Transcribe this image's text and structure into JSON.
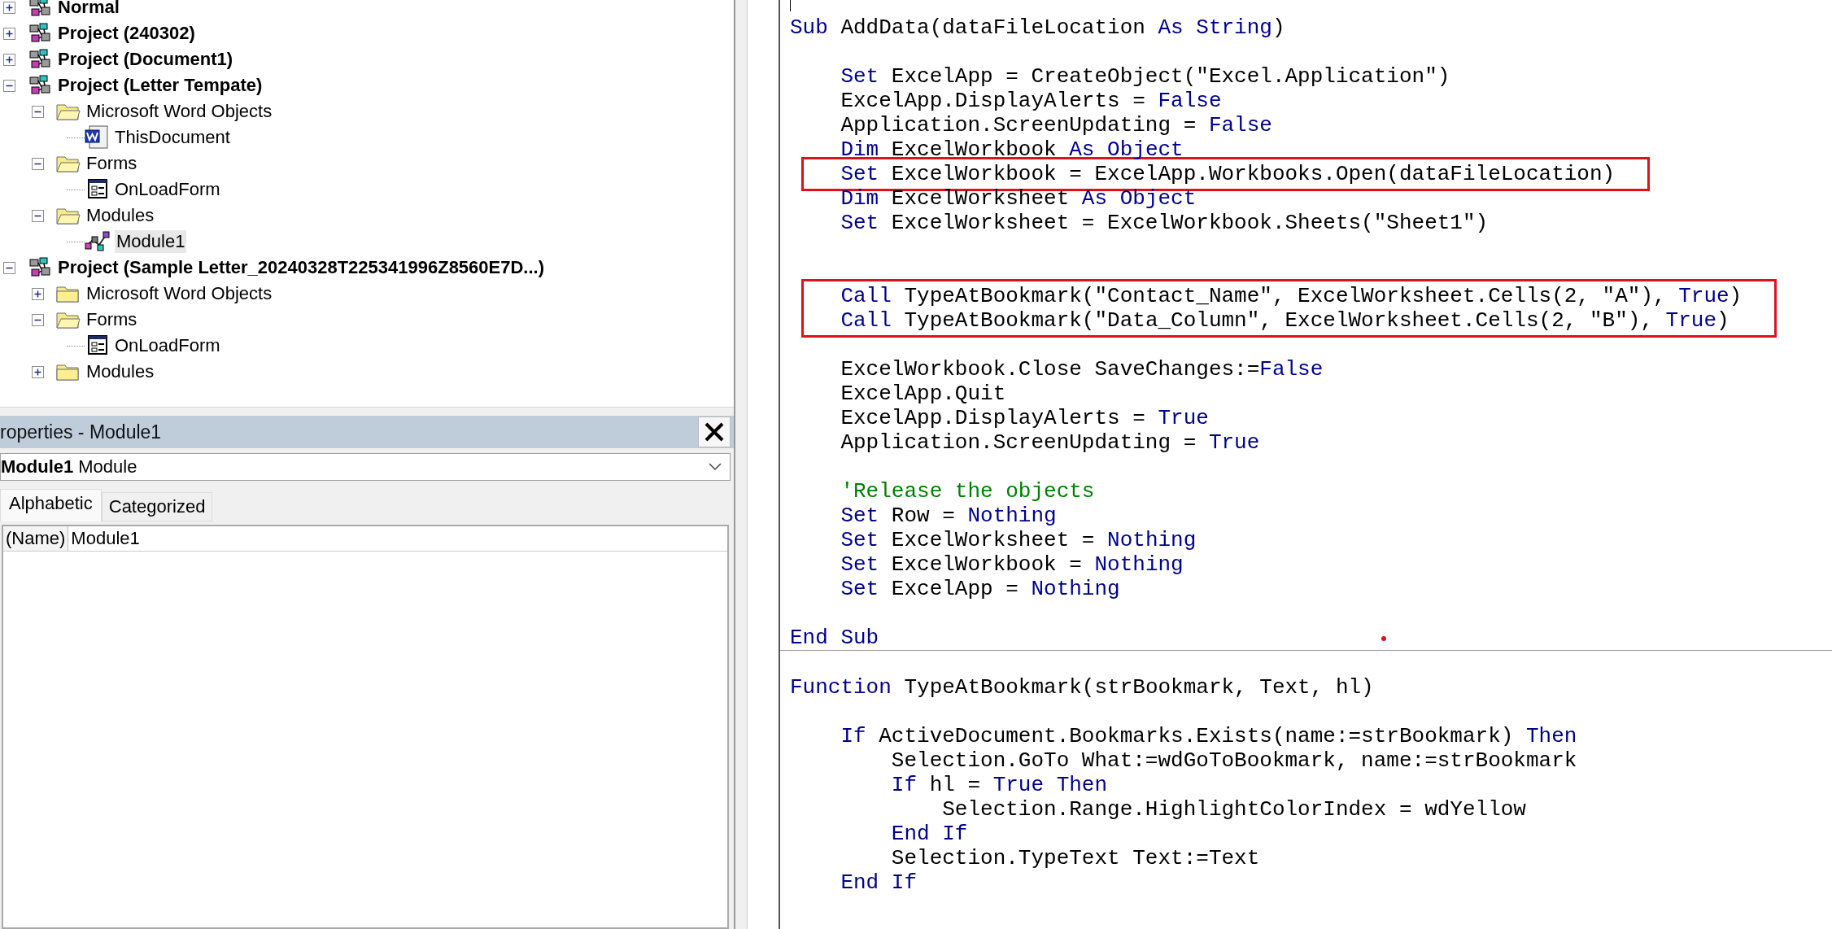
{
  "project_tree": [
    {
      "kind": "project",
      "label": "Normal",
      "expanded": false,
      "selected": false
    },
    {
      "kind": "project",
      "label": "Project (240302)",
      "expanded": false,
      "selected": false
    },
    {
      "kind": "project",
      "label": "Project (Document1)",
      "expanded": false,
      "selected": false
    },
    {
      "kind": "project",
      "label": "Project (Letter Tempate)",
      "expanded": true,
      "selected": false,
      "children": [
        {
          "kind": "folder",
          "label": "Microsoft Word Objects",
          "expanded": true,
          "selected": false,
          "children": [
            {
              "kind": "document",
              "label": "ThisDocument",
              "selected": false
            }
          ]
        },
        {
          "kind": "folder",
          "label": "Forms",
          "expanded": true,
          "selected": false,
          "children": [
            {
              "kind": "form",
              "label": "OnLoadForm",
              "selected": false
            }
          ]
        },
        {
          "kind": "folder",
          "label": "Modules",
          "expanded": true,
          "selected": false,
          "children": [
            {
              "kind": "module",
              "label": "Module1",
              "selected": true
            }
          ]
        }
      ]
    },
    {
      "kind": "project",
      "label": "Project (Sample Letter_20240328T225341996Z8560E7D...)",
      "expanded": true,
      "selected": false,
      "children": [
        {
          "kind": "folder",
          "label": "Microsoft Word Objects",
          "expanded": false,
          "selected": false
        },
        {
          "kind": "folder",
          "label": "Forms",
          "expanded": true,
          "selected": false,
          "children": [
            {
              "kind": "form",
              "label": "OnLoadForm",
              "selected": false
            }
          ]
        },
        {
          "kind": "folder",
          "label": "Modules",
          "expanded": false,
          "selected": false
        }
      ]
    }
  ],
  "properties": {
    "title": "roperties - Module1",
    "object": {
      "name": "Module1",
      "type": "Module"
    },
    "tabs": [
      {
        "label": "Alphabetic",
        "selected": true
      },
      {
        "label": "Categorized",
        "selected": false
      }
    ],
    "rows": [
      {
        "name": "(Name)",
        "value": "Module1"
      }
    ]
  },
  "code": {
    "procedures": [
      {
        "lines": [
          {
            "kind": "code",
            "boxed": false,
            "segments": [
              {
                "kind": "keyword",
                "text": "Sub"
              },
              {
                "kind": "plain",
                "text": " AddData(dataFileLocation "
              },
              {
                "kind": "keyword",
                "text": "As String"
              },
              {
                "kind": "plain",
                "text": ")"
              }
            ]
          },
          {
            "kind": "blank",
            "boxed": false
          },
          {
            "kind": "code",
            "boxed": false,
            "segments": [
              {
                "kind": "keyword",
                "text": "    Set"
              },
              {
                "kind": "plain",
                "text": " ExcelApp = CreateObject(\"Excel.Application\")"
              }
            ]
          },
          {
            "kind": "code",
            "boxed": false,
            "segments": [
              {
                "kind": "plain",
                "text": "    ExcelApp.DisplayAlerts = "
              },
              {
                "kind": "keyword",
                "text": "False"
              }
            ]
          },
          {
            "kind": "code",
            "boxed": false,
            "segments": [
              {
                "kind": "plain",
                "text": "    Application.ScreenUpdating = "
              },
              {
                "kind": "keyword",
                "text": "False"
              }
            ]
          },
          {
            "kind": "code",
            "boxed": false,
            "segments": [
              {
                "kind": "keyword",
                "text": "    Dim"
              },
              {
                "kind": "plain",
                "text": " ExcelWorkbook "
              },
              {
                "kind": "keyword",
                "text": "As Object"
              }
            ]
          },
          {
            "kind": "code",
            "boxed": true,
            "segments": [
              {
                "kind": "keyword",
                "text": "    Set"
              },
              {
                "kind": "plain",
                "text": " ExcelWorkbook = ExcelApp.Workbooks.Open(dataFileLocation)"
              }
            ]
          },
          {
            "kind": "code",
            "boxed": false,
            "segments": [
              {
                "kind": "keyword",
                "text": "    Dim"
              },
              {
                "kind": "plain",
                "text": " ExcelWorksheet "
              },
              {
                "kind": "keyword",
                "text": "As Object"
              }
            ]
          },
          {
            "kind": "code",
            "boxed": false,
            "segments": [
              {
                "kind": "keyword",
                "text": "    Set"
              },
              {
                "kind": "plain",
                "text": " ExcelWorksheet = ExcelWorkbook.Sheets(\"Sheet1\")"
              }
            ]
          },
          {
            "kind": "blank",
            "boxed": false
          },
          {
            "kind": "blank",
            "boxed": false
          },
          {
            "kind": "code",
            "boxed": true,
            "segments": [
              {
                "kind": "keyword",
                "text": "    Call"
              },
              {
                "kind": "plain",
                "text": " TypeAtBookmark(\"Contact_Name\", ExcelWorksheet.Cells(2, \"A\"), "
              },
              {
                "kind": "keyword",
                "text": "True"
              },
              {
                "kind": "plain",
                "text": ")"
              }
            ]
          },
          {
            "kind": "code",
            "boxed": true,
            "segments": [
              {
                "kind": "keyword",
                "text": "    Call"
              },
              {
                "kind": "plain",
                "text": " TypeAtBookmark(\"Data_Column\", ExcelWorksheet.Cells(2, \"B\"), "
              },
              {
                "kind": "keyword",
                "text": "True"
              },
              {
                "kind": "plain",
                "text": ")"
              }
            ]
          },
          {
            "kind": "blank",
            "boxed": false
          },
          {
            "kind": "code",
            "boxed": false,
            "segments": [
              {
                "kind": "plain",
                "text": "    ExcelWorkbook.Close SaveChanges:="
              },
              {
                "kind": "keyword",
                "text": "False"
              }
            ]
          },
          {
            "kind": "code",
            "boxed": false,
            "segments": [
              {
                "kind": "plain",
                "text": "    ExcelApp.Quit"
              }
            ]
          },
          {
            "kind": "code",
            "boxed": false,
            "segments": [
              {
                "kind": "plain",
                "text": "    ExcelApp.DisplayAlerts = "
              },
              {
                "kind": "keyword",
                "text": "True"
              }
            ]
          },
          {
            "kind": "code",
            "boxed": false,
            "segments": [
              {
                "kind": "plain",
                "text": "    Application.ScreenUpdating = "
              },
              {
                "kind": "keyword",
                "text": "True"
              }
            ]
          },
          {
            "kind": "blank",
            "boxed": false
          },
          {
            "kind": "code",
            "boxed": false,
            "segments": [
              {
                "kind": "comment",
                "text": "    'Release the objects"
              }
            ]
          },
          {
            "kind": "code",
            "boxed": false,
            "segments": [
              {
                "kind": "keyword",
                "text": "    Set"
              },
              {
                "kind": "plain",
                "text": " Row = "
              },
              {
                "kind": "keyword",
                "text": "Nothing"
              }
            ]
          },
          {
            "kind": "code",
            "boxed": false,
            "segments": [
              {
                "kind": "keyword",
                "text": "    Set"
              },
              {
                "kind": "plain",
                "text": " ExcelWorksheet = "
              },
              {
                "kind": "keyword",
                "text": "Nothing"
              }
            ]
          },
          {
            "kind": "code",
            "boxed": false,
            "segments": [
              {
                "kind": "keyword",
                "text": "    Set"
              },
              {
                "kind": "plain",
                "text": " ExcelWorkbook = "
              },
              {
                "kind": "keyword",
                "text": "Nothing"
              }
            ]
          },
          {
            "kind": "code",
            "boxed": false,
            "segments": [
              {
                "kind": "keyword",
                "text": "    Set"
              },
              {
                "kind": "plain",
                "text": " ExcelApp = "
              },
              {
                "kind": "keyword",
                "text": "Nothing"
              }
            ]
          },
          {
            "kind": "blank",
            "boxed": false
          },
          {
            "kind": "code",
            "boxed": false,
            "segments": [
              {
                "kind": "keyword",
                "text": "End Sub"
              }
            ]
          }
        ]
      },
      {
        "lines": [
          {
            "kind": "blank",
            "boxed": false
          },
          {
            "kind": "code",
            "boxed": false,
            "segments": [
              {
                "kind": "keyword",
                "text": "Function"
              },
              {
                "kind": "plain",
                "text": " TypeAtBookmark(strBookmark, Text, hl)"
              }
            ]
          },
          {
            "kind": "blank",
            "boxed": false
          },
          {
            "kind": "code",
            "boxed": false,
            "segments": [
              {
                "kind": "keyword",
                "text": "    If"
              },
              {
                "kind": "plain",
                "text": " ActiveDocument.Bookmarks.Exists(name:=strBookmark) "
              },
              {
                "kind": "keyword",
                "text": "Then"
              }
            ]
          },
          {
            "kind": "code",
            "boxed": false,
            "segments": [
              {
                "kind": "plain",
                "text": "        Selection.GoTo What:=wdGoToBookmark, name:=strBookmark"
              }
            ]
          },
          {
            "kind": "code",
            "boxed": false,
            "segments": [
              {
                "kind": "keyword",
                "text": "        If"
              },
              {
                "kind": "plain",
                "text": " hl = "
              },
              {
                "kind": "keyword",
                "text": "True Then"
              }
            ]
          },
          {
            "kind": "code",
            "boxed": false,
            "segments": [
              {
                "kind": "plain",
                "text": "            Selection.Range.HighlightColorIndex = wdYellow"
              }
            ]
          },
          {
            "kind": "code",
            "boxed": false,
            "segments": [
              {
                "kind": "keyword",
                "text": "        End If"
              }
            ]
          },
          {
            "kind": "code",
            "boxed": false,
            "segments": [
              {
                "kind": "plain",
                "text": "        Selection.TypeText Text:=Text"
              }
            ]
          },
          {
            "kind": "code",
            "boxed": false,
            "segments": [
              {
                "kind": "keyword",
                "text": "    End If"
              }
            ]
          }
        ]
      }
    ]
  }
}
